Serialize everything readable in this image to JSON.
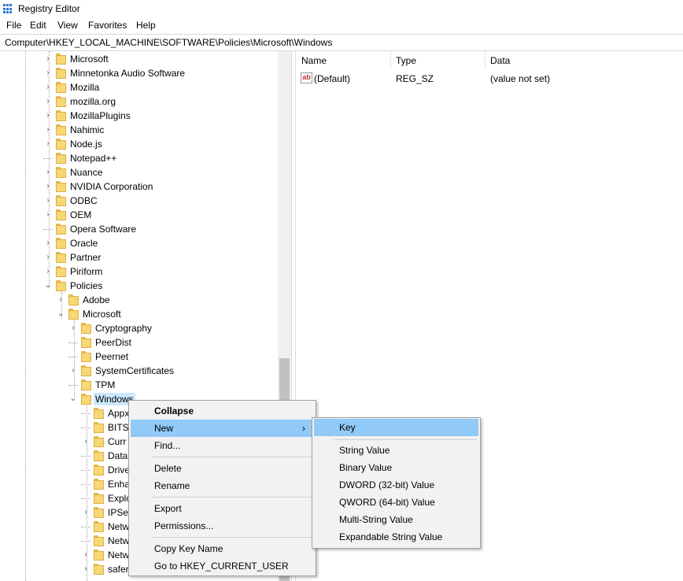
{
  "window": {
    "title": "Registry Editor"
  },
  "menu": [
    "File",
    "Edit",
    "View",
    "Favorites",
    "Help"
  ],
  "address": "Computer\\HKEY_LOCAL_MACHINE\\SOFTWARE\\Policies\\Microsoft\\Windows",
  "tree": [
    {
      "label": "Microsoft",
      "level": 0,
      "exp": "collapsed"
    },
    {
      "label": "Minnetonka Audio Software",
      "level": 0,
      "exp": "collapsed"
    },
    {
      "label": "Mozilla",
      "level": 0,
      "exp": "collapsed"
    },
    {
      "label": "mozilla.org",
      "level": 0,
      "exp": "collapsed"
    },
    {
      "label": "MozillaPlugins",
      "level": 0,
      "exp": "collapsed"
    },
    {
      "label": "Nahimic",
      "level": 0,
      "exp": "collapsed"
    },
    {
      "label": "Node.js",
      "level": 0,
      "exp": "collapsed"
    },
    {
      "label": "Notepad++",
      "level": 0,
      "exp": "none"
    },
    {
      "label": "Nuance",
      "level": 0,
      "exp": "collapsed"
    },
    {
      "label": "NVIDIA Corporation",
      "level": 0,
      "exp": "collapsed"
    },
    {
      "label": "ODBC",
      "level": 0,
      "exp": "collapsed"
    },
    {
      "label": "OEM",
      "level": 0,
      "exp": "collapsed"
    },
    {
      "label": "Opera Software",
      "level": 0,
      "exp": "none"
    },
    {
      "label": "Oracle",
      "level": 0,
      "exp": "collapsed"
    },
    {
      "label": "Partner",
      "level": 0,
      "exp": "collapsed"
    },
    {
      "label": "Piriform",
      "level": 0,
      "exp": "collapsed"
    },
    {
      "label": "Policies",
      "level": 0,
      "exp": "expanded"
    },
    {
      "label": "Adobe",
      "level": 1,
      "exp": "collapsed"
    },
    {
      "label": "Microsoft",
      "level": 1,
      "exp": "expanded"
    },
    {
      "label": "Cryptography",
      "level": 2,
      "exp": "collapsed"
    },
    {
      "label": "PeerDist",
      "level": 2,
      "exp": "none"
    },
    {
      "label": "Peernet",
      "level": 2,
      "exp": "none"
    },
    {
      "label": "SystemCertificates",
      "level": 2,
      "exp": "collapsed"
    },
    {
      "label": "TPM",
      "level": 2,
      "exp": "none"
    },
    {
      "label": "Windows",
      "level": 2,
      "exp": "expanded",
      "selected": true
    },
    {
      "label": "Appx",
      "level": 3,
      "exp": "none"
    },
    {
      "label": "BITS",
      "level": 3,
      "exp": "none"
    },
    {
      "label": "Curr",
      "level": 3,
      "exp": "collapsed"
    },
    {
      "label": "Data",
      "level": 3,
      "exp": "none"
    },
    {
      "label": "Drive",
      "level": 3,
      "exp": "none"
    },
    {
      "label": "Enha",
      "level": 3,
      "exp": "none"
    },
    {
      "label": "Explo",
      "level": 3,
      "exp": "none"
    },
    {
      "label": "IPSe",
      "level": 3,
      "exp": "collapsed"
    },
    {
      "label": "Netw",
      "level": 3,
      "exp": "none"
    },
    {
      "label": "Netw",
      "level": 3,
      "exp": "none"
    },
    {
      "label": "Netw",
      "level": 3,
      "exp": "collapsed"
    },
    {
      "label": "safer",
      "level": 3,
      "exp": "collapsed"
    }
  ],
  "values_pane": {
    "headers": [
      "Name",
      "Type",
      "Data"
    ],
    "rows": [
      {
        "name": "(Default)",
        "type": "REG_SZ",
        "data": "(value not set)",
        "icon_text": "ab"
      }
    ]
  },
  "context_menu": {
    "items": [
      "Collapse",
      "New",
      "Find...",
      "Delete",
      "Rename",
      "Export",
      "Permissions...",
      "Copy Key Name",
      "Go to HKEY_CURRENT_USER"
    ],
    "submenu_arrow": "›"
  },
  "submenu": {
    "items": [
      "Key",
      "String Value",
      "Binary Value",
      "DWORD (32-bit) Value",
      "QWORD (64-bit) Value",
      "Multi-String Value",
      "Expandable String Value"
    ]
  },
  "colors": {
    "highlight": "#91c9f7",
    "selection": "#cce8ff",
    "folder": "#f8d775",
    "accent": "#2b7bd0"
  }
}
